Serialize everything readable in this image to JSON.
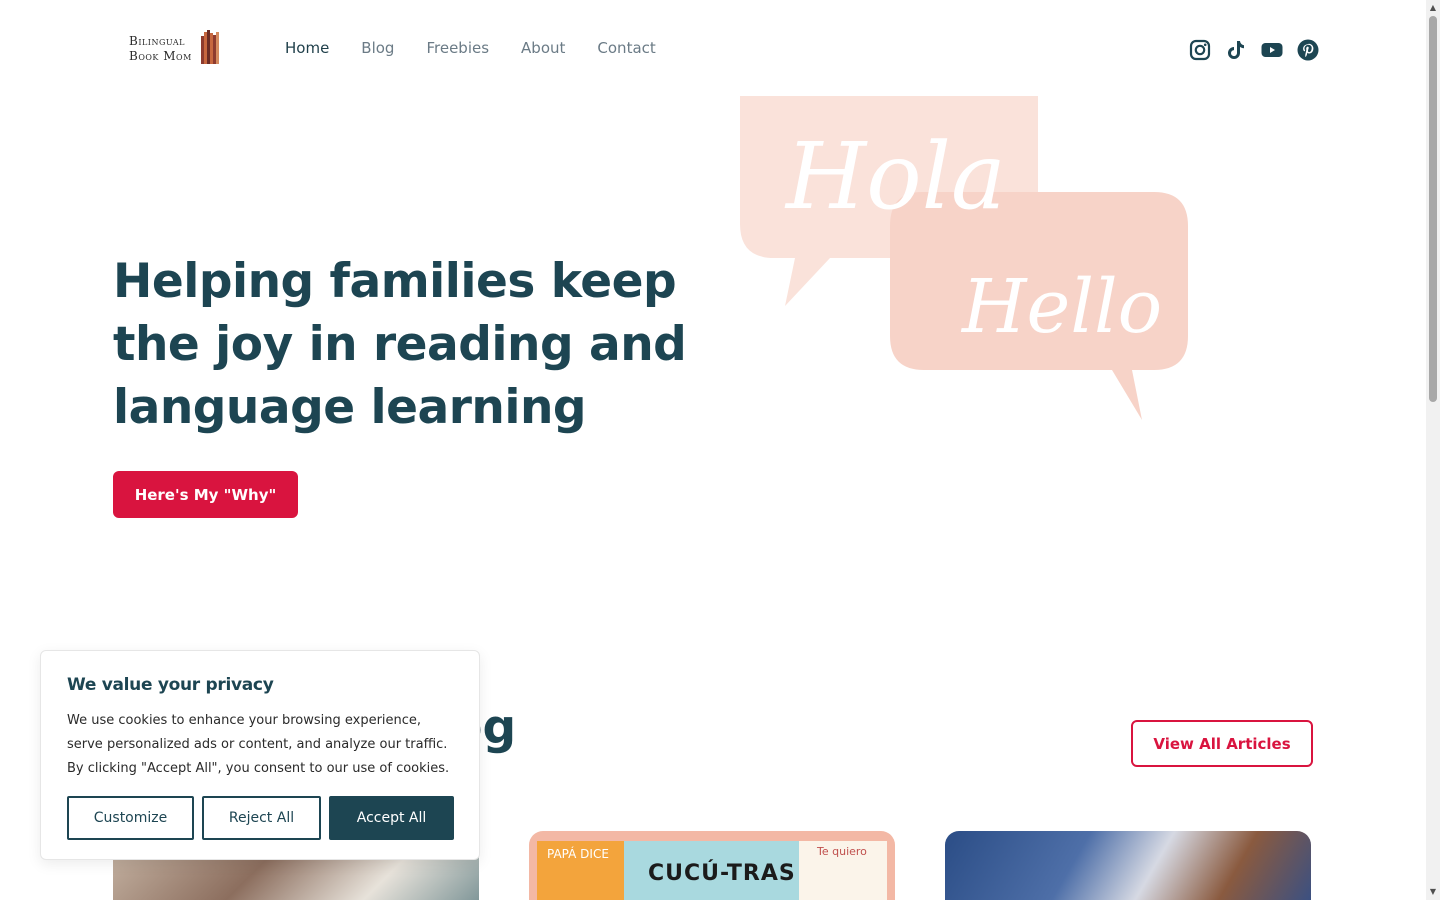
{
  "header": {
    "logo": {
      "line1": "Bilingual",
      "line2": "Book Mom"
    },
    "nav": [
      {
        "label": "Home",
        "active": true
      },
      {
        "label": "Blog",
        "active": false
      },
      {
        "label": "Freebies",
        "active": false
      },
      {
        "label": "About",
        "active": false
      },
      {
        "label": "Contact",
        "active": false
      }
    ],
    "social": [
      "instagram-icon",
      "tiktok-icon",
      "youtube-icon",
      "pinterest-icon"
    ]
  },
  "hero": {
    "title": "Helping families keep the joy in reading and language learning",
    "button_label": "Here's My \"Why\"",
    "bubble_words": [
      "Hola",
      "Hello"
    ]
  },
  "blog": {
    "title_fragment": "e Blog",
    "view_all_label": "View All Articles",
    "card2_books": [
      "PAPÁ DICE",
      "CUCÚ-TRAS",
      "Te quiero"
    ]
  },
  "cookie": {
    "title": "We value your privacy",
    "text": "We use cookies to enhance your browsing experience, serve personalized ads or content, and analyze our traffic. By clicking \"Accept All\", you consent to our use of cookies.",
    "customize_label": "Customize",
    "reject_label": "Reject All",
    "accept_label": "Accept All"
  },
  "colors": {
    "brand_dark": "#1d4552",
    "brand_red": "#d9143f",
    "bubble_pink": "#f7d3c8"
  }
}
